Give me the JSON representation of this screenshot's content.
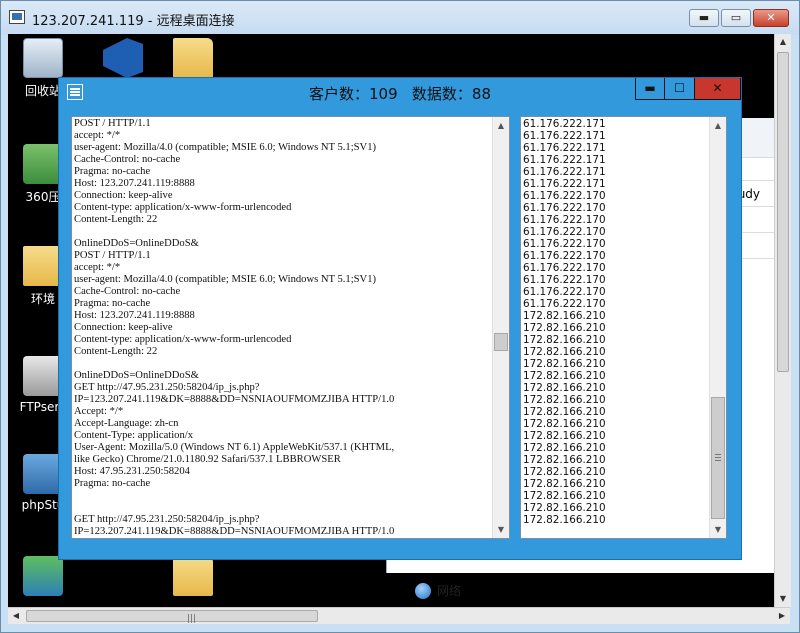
{
  "rdp": {
    "title": "123.207.241.119 - 远程桌面连接",
    "min_glyph": "▬",
    "max_glyph": "▭",
    "close_glyph": "✕"
  },
  "desktop": {
    "icons": [
      {
        "label": "回收站",
        "icon": "recycle-bin-icon"
      },
      {
        "label": "",
        "icon": "vscode-icon"
      },
      {
        "label": "",
        "icon": "folder-icon"
      },
      {
        "label": "360压",
        "icon": "zip-icon"
      },
      {
        "label": "环境",
        "icon": "folder-icon"
      },
      {
        "label": "FTPserv",
        "icon": "ftp-server-icon"
      },
      {
        "label": "phpStu",
        "icon": "phpstudy-icon"
      },
      {
        "label": "",
        "icon": "network-app-icon"
      },
      {
        "label": "",
        "icon": "folder-icon"
      }
    ]
  },
  "explorer": {
    "partial_text": "tudy",
    "network_label": "网络"
  },
  "app": {
    "title": "客户数：109   数据数：88",
    "min_glyph": "▬",
    "max_glyph": "☐",
    "close_glyph": "✕",
    "log_text": "POST / HTTP/1.1\naccept: */*\nuser-agent: Mozilla/4.0 (compatible; MSIE 6.0; Windows NT 5.1;SV1)\nCache-Control: no-cache\nPragma: no-cache\nHost: 123.207.241.119:8888\nConnection: keep-alive\nContent-type: application/x-www-form-urlencoded\nContent-Length: 22\n\nOnlineDDoS=OnlineDDoS&\nPOST / HTTP/1.1\naccept: */*\nuser-agent: Mozilla/4.0 (compatible; MSIE 6.0; Windows NT 5.1;SV1)\nCache-Control: no-cache\nPragma: no-cache\nHost: 123.207.241.119:8888\nConnection: keep-alive\nContent-type: application/x-www-form-urlencoded\nContent-Length: 22\n\nOnlineDDoS=OnlineDDoS&\nGET http://47.95.231.250:58204/ip_js.php?\nIP=123.207.241.119&DK=8888&DD=NSNIAOUFMOMZJIBA HTTP/1.0\nAccept: */*\nAccept-Language: zh-cn\nContent-Type: application/x\nUser-Agent: Mozilla/5.0 (Windows NT 6.1) AppleWebKit/537.1 (KHTML,\nlike Gecko) Chrome/21.0.1180.92 Safari/537.1 LBBROWSER\nHost: 47.95.231.250:58204\nPragma: no-cache\n\n\nGET http://47.95.231.250:58204/ip_js.php?\nIP=123.207.241.119&DK=8888&DD=NSNIAOUFMOMZJIBA HTTP/1.0",
    "ip_list": "61.176.222.171\n61.176.222.171\n61.176.222.171\n61.176.222.171\n61.176.222.171\n61.176.222.171\n61.176.222.170\n61.176.222.170\n61.176.222.170\n61.176.222.170\n61.176.222.170\n61.176.222.170\n61.176.222.170\n61.176.222.170\n61.176.222.170\n61.176.222.170\n172.82.166.210\n172.82.166.210\n172.82.166.210\n172.82.166.210\n172.82.166.210\n172.82.166.210\n172.82.166.210\n172.82.166.210\n172.82.166.210\n172.82.166.210\n172.82.166.210\n172.82.166.210\n172.82.166.210\n172.82.166.210\n172.82.166.210\n172.82.166.210\n172.82.166.210\n172.82.166.210"
  },
  "colors": {
    "app_frame": "#3399dd",
    "close_red": "#c7372d"
  }
}
